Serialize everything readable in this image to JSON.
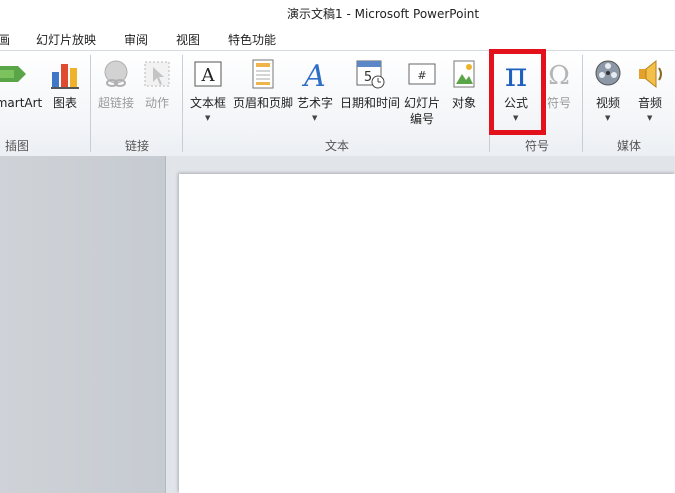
{
  "window": {
    "title": "演示文稿1 - Microsoft PowerPoint"
  },
  "menu": {
    "tabs": [
      "画",
      "幻灯片放映",
      "审阅",
      "视图",
      "特色功能"
    ]
  },
  "ribbon": {
    "buttons": {
      "smartart": "martArt",
      "chart": "图表",
      "hyperlink": "超链接",
      "action": "动作",
      "textbox": "文本框",
      "header_footer": "页眉和页脚",
      "wordart": "艺术字",
      "datetime": "日期和时间",
      "slide_number_1": "幻灯片",
      "slide_number_2": "编号",
      "object": "对象",
      "equation": "公式",
      "symbol": "符号",
      "video": "视频",
      "audio": "音频"
    },
    "groups": {
      "illustrations": "插图",
      "links": "链接",
      "text": "文本",
      "symbols": "符号",
      "media": "媒体"
    }
  },
  "colors": {
    "highlight": "#e2111b",
    "accent_blue": "#1f5fbf"
  }
}
